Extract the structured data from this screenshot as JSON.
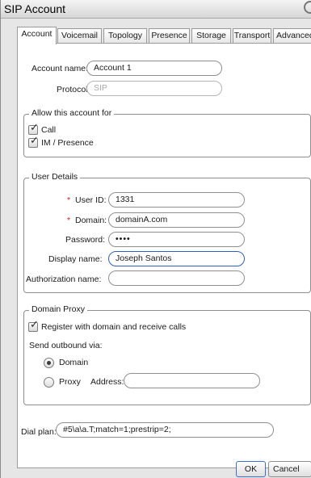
{
  "window": {
    "title": "SIP Account"
  },
  "tabs": [
    "Account",
    "Voicemail",
    "Topology",
    "Presence",
    "Storage",
    "Transport",
    "Advanced"
  ],
  "account": {
    "name_label": "Account name:",
    "name_value": "Account 1",
    "protocol_label": "Protocol:",
    "protocol_value": "SIP"
  },
  "allow": {
    "legend": "Allow this account for",
    "call_label": "Call",
    "call_checked": true,
    "im_label": "IM / Presence",
    "im_checked": true
  },
  "user_details": {
    "legend": "User Details",
    "required_marker": "*",
    "user_id_label": "User ID:",
    "user_id_value": "1331",
    "domain_label": "Domain:",
    "domain_value": "domainA.com",
    "password_label": "Password:",
    "password_value": "••••",
    "display_name_label": "Display name:",
    "display_name_value": "Joseph Santos",
    "auth_name_label": "Authorization name:",
    "auth_name_value": ""
  },
  "domain_proxy": {
    "legend": "Domain Proxy",
    "register_label": "Register with domain and receive calls",
    "register_checked": true,
    "send_outbound_label": "Send outbound via:",
    "domain_option": "Domain",
    "proxy_option": "Proxy",
    "selected": "Domain",
    "address_label": "Address:",
    "address_value": ""
  },
  "dial_plan": {
    "label": "Dial plan:",
    "value": "#5\\a\\a.T;match=1;prestrip=2;"
  },
  "buttons": {
    "ok": "OK",
    "cancel": "Cancel"
  }
}
